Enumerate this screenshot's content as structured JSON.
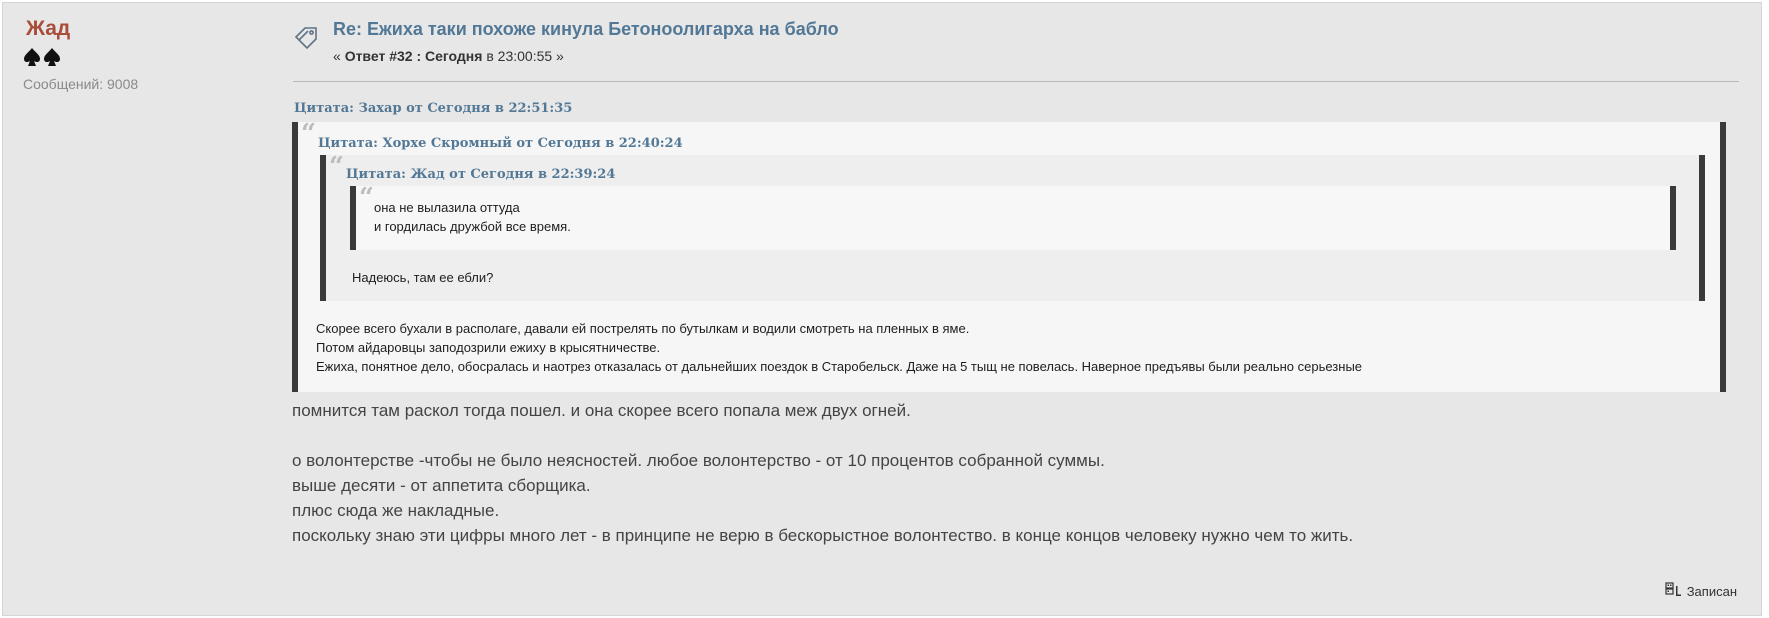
{
  "poster": {
    "name": "Жад",
    "posts_label": "Сообщений: 9008",
    "rank_icon": "spade-stars-icon"
  },
  "post": {
    "title": "Re: Ежиха таки похоже кинула Бетоноолигарха на бабло",
    "meta_prefix": "« ",
    "meta_reply": "Ответ #32 : Сегодня",
    "meta_time": " в 23:00:55 »"
  },
  "quotes": {
    "outer_cite": "Цитата: Захар от Сегодня в 22:51:35",
    "level2_cite": "Цитата: Хорхе Скромный от Сегодня в 22:40:24",
    "level3_cite": "Цитата: Жад от Сегодня в 22:39:24",
    "level3_lines": [
      "она не вылазила оттуда",
      "и гордилась дружбой все время."
    ],
    "level2_text": "Надеюсь,  там ее ебли?",
    "level1_lines": [
      "Скорее всего бухали в располаге, давали ей пострелять по бутылкам и водили смотреть на пленных в яме.",
      "Потом айдаровцы заподозрили ежиху в крысятничестве.",
      "Ежиха, понятное дело, обосралась и наотрез отказалась от дальнейших поездок в Старобельск. Даже на 5 тыщ не повелась. Наверное предъявы были реально серьезные"
    ]
  },
  "body": {
    "lines": [
      "помнится там раскол тогда пошел. и она скорее всего попала меж двух огней.",
      "",
      "о волонтерстве -чтобы не было неясностей. любое волонтерство - от 10 процентов собранной суммы.",
      "выше десяти - от аппетита сборщика.",
      "плюс сюда же накладные.",
      "поскольку знаю эти цифры много лет - в принципе не верю в бескорыстное волонтество. в конце концов человеку нужно чем то жить."
    ]
  },
  "footer": {
    "report_label": "Записан",
    "report_icon": "report-icon"
  },
  "colors": {
    "poster_name": "#a94c3a",
    "link": "#527896",
    "background": "#e7e7e7",
    "quote_border": "#3a3a3a"
  }
}
